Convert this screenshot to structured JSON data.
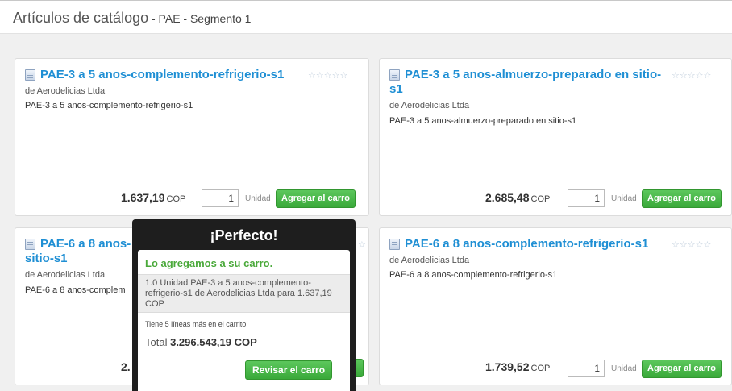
{
  "header": {
    "title": "Artículos de catálogo",
    "subtitle": " - PAE - Segmento 1"
  },
  "products": [
    {
      "title": "PAE-3 a 5 anos-complemento-refrigerio-s1",
      "vendor": "de Aerodelicias Ltda",
      "description": "PAE-3 a 5 anos-complemento-refrigerio-s1",
      "price": "1.637,19",
      "currency": "COP",
      "quantity": "1",
      "unit": "Unidad",
      "add_label": "Agregar al carro",
      "rating": "☆☆☆☆☆"
    },
    {
      "title_line1": "PAE-3 a 5 anos-almuerzo-preparado en sitio-",
      "title_line2": "s1",
      "vendor": "de Aerodelicias Ltda",
      "description": "PAE-3 a 5 anos-almuerzo-preparado en sitio-s1",
      "price": "2.685,48",
      "currency": "COP",
      "quantity": "1",
      "unit": "Unidad",
      "add_label": "Agregar al carro",
      "rating": "☆☆☆☆☆"
    },
    {
      "title_line1": "PAE-6 a 8 anos-",
      "title_line2": "sitio-s1",
      "vendor": "de Aerodelicias Ltda",
      "description": "PAE-6 a 8 anos-complem",
      "price": "2.",
      "add_label": "",
      "rating": "☆"
    },
    {
      "title": "PAE-6 a 8 anos-complemento-refrigerio-s1",
      "vendor": "de Aerodelicias Ltda",
      "description": "PAE-6 a 8 anos-complemento-refrigerio-s1",
      "price": "1.739,52",
      "currency": "COP",
      "quantity": "1",
      "unit": "Unidad",
      "add_label": "Agregar al carro",
      "rating": "☆☆☆☆☆"
    }
  ],
  "popup": {
    "title": "¡Perfecto!",
    "confirmation": "Lo agregamos a su carro.",
    "detail": "1.0 Unidad PAE-3 a 5 anos-complemento-refrigerio-s1 de Aerodelicias Ltda para 1.637,19 COP",
    "lines_note": "Tiene 5 líneas más en el carrito.",
    "total_label": "Total",
    "total_value": "3.296.543,19 COP",
    "review_label": "Revisar el carro"
  }
}
